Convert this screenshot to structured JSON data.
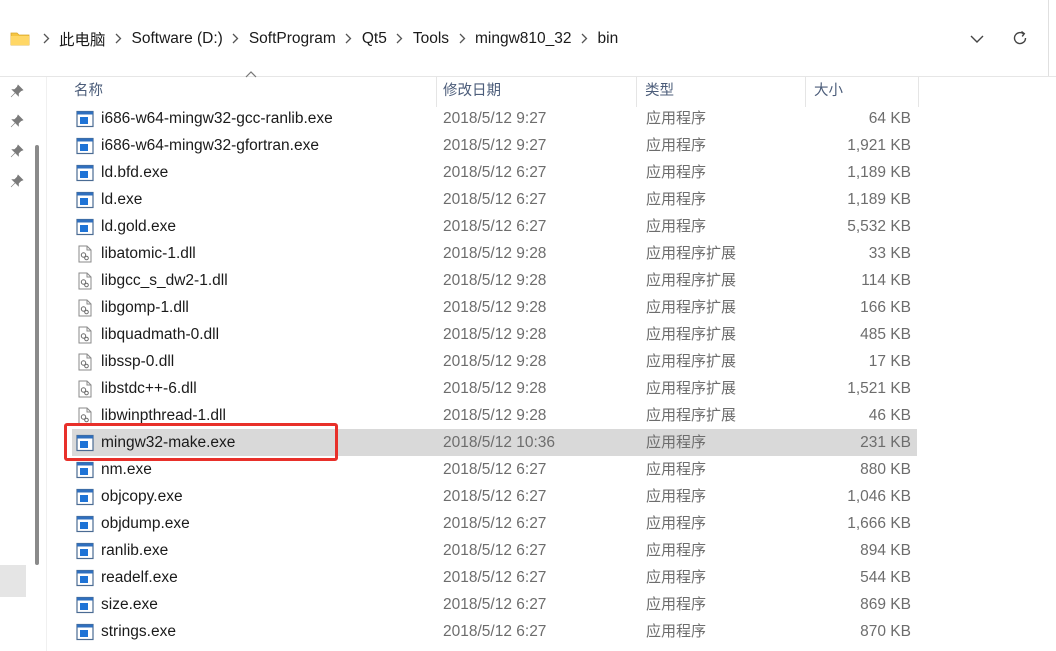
{
  "breadcrumb": {
    "items": [
      {
        "label": "此电脑"
      },
      {
        "label": "Software (D:)"
      },
      {
        "label": "SoftProgram"
      },
      {
        "label": "Qt5"
      },
      {
        "label": "Tools"
      },
      {
        "label": "mingw810_32"
      },
      {
        "label": "bin"
      }
    ]
  },
  "columns": {
    "name": "名称",
    "date": "修改日期",
    "type": "类型",
    "size": "大小"
  },
  "files": [
    {
      "name": "i686-w64-mingw32-gcc-ranlib.exe",
      "date": "2018/5/12 9:27",
      "type": "应用程序",
      "size": "64 KB",
      "icon": "exe-icon"
    },
    {
      "name": "i686-w64-mingw32-gfortran.exe",
      "date": "2018/5/12 9:27",
      "type": "应用程序",
      "size": "1,921 KB",
      "icon": "exe-icon"
    },
    {
      "name": "ld.bfd.exe",
      "date": "2018/5/12 6:27",
      "type": "应用程序",
      "size": "1,189 KB",
      "icon": "exe-icon"
    },
    {
      "name": "ld.exe",
      "date": "2018/5/12 6:27",
      "type": "应用程序",
      "size": "1,189 KB",
      "icon": "exe-icon"
    },
    {
      "name": "ld.gold.exe",
      "date": "2018/5/12 6:27",
      "type": "应用程序",
      "size": "5,532 KB",
      "icon": "exe-icon"
    },
    {
      "name": "libatomic-1.dll",
      "date": "2018/5/12 9:28",
      "type": "应用程序扩展",
      "size": "33 KB",
      "icon": "dll-icon"
    },
    {
      "name": "libgcc_s_dw2-1.dll",
      "date": "2018/5/12 9:28",
      "type": "应用程序扩展",
      "size": "114 KB",
      "icon": "dll-icon"
    },
    {
      "name": "libgomp-1.dll",
      "date": "2018/5/12 9:28",
      "type": "应用程序扩展",
      "size": "166 KB",
      "icon": "dll-icon"
    },
    {
      "name": "libquadmath-0.dll",
      "date": "2018/5/12 9:28",
      "type": "应用程序扩展",
      "size": "485 KB",
      "icon": "dll-icon"
    },
    {
      "name": "libssp-0.dll",
      "date": "2018/5/12 9:28",
      "type": "应用程序扩展",
      "size": "17 KB",
      "icon": "dll-icon"
    },
    {
      "name": "libstdc++-6.dll",
      "date": "2018/5/12 9:28",
      "type": "应用程序扩展",
      "size": "1,521 KB",
      "icon": "dll-icon"
    },
    {
      "name": "libwinpthread-1.dll",
      "date": "2018/5/12 9:28",
      "type": "应用程序扩展",
      "size": "46 KB",
      "icon": "dll-icon"
    },
    {
      "name": "mingw32-make.exe",
      "date": "2018/5/12 10:36",
      "type": "应用程序",
      "size": "231 KB",
      "icon": "exe-icon",
      "selected": true
    },
    {
      "name": "nm.exe",
      "date": "2018/5/12 6:27",
      "type": "应用程序",
      "size": "880 KB",
      "icon": "exe-icon"
    },
    {
      "name": "objcopy.exe",
      "date": "2018/5/12 6:27",
      "type": "应用程序",
      "size": "1,046 KB",
      "icon": "exe-icon"
    },
    {
      "name": "objdump.exe",
      "date": "2018/5/12 6:27",
      "type": "应用程序",
      "size": "1,666 KB",
      "icon": "exe-icon"
    },
    {
      "name": "ranlib.exe",
      "date": "2018/5/12 6:27",
      "type": "应用程序",
      "size": "894 KB",
      "icon": "exe-icon"
    },
    {
      "name": "readelf.exe",
      "date": "2018/5/12 6:27",
      "type": "应用程序",
      "size": "544 KB",
      "icon": "exe-icon"
    },
    {
      "name": "size.exe",
      "date": "2018/5/12 6:27",
      "type": "应用程序",
      "size": "869 KB",
      "icon": "exe-icon"
    },
    {
      "name": "strings.exe",
      "date": "2018/5/12 6:27",
      "type": "应用程序",
      "size": "870 KB",
      "icon": "exe-icon"
    }
  ],
  "colors": {
    "highlight_border": "#e8302a",
    "selected_row": "#d9d9d9",
    "header_text": "#4c5d7a"
  }
}
